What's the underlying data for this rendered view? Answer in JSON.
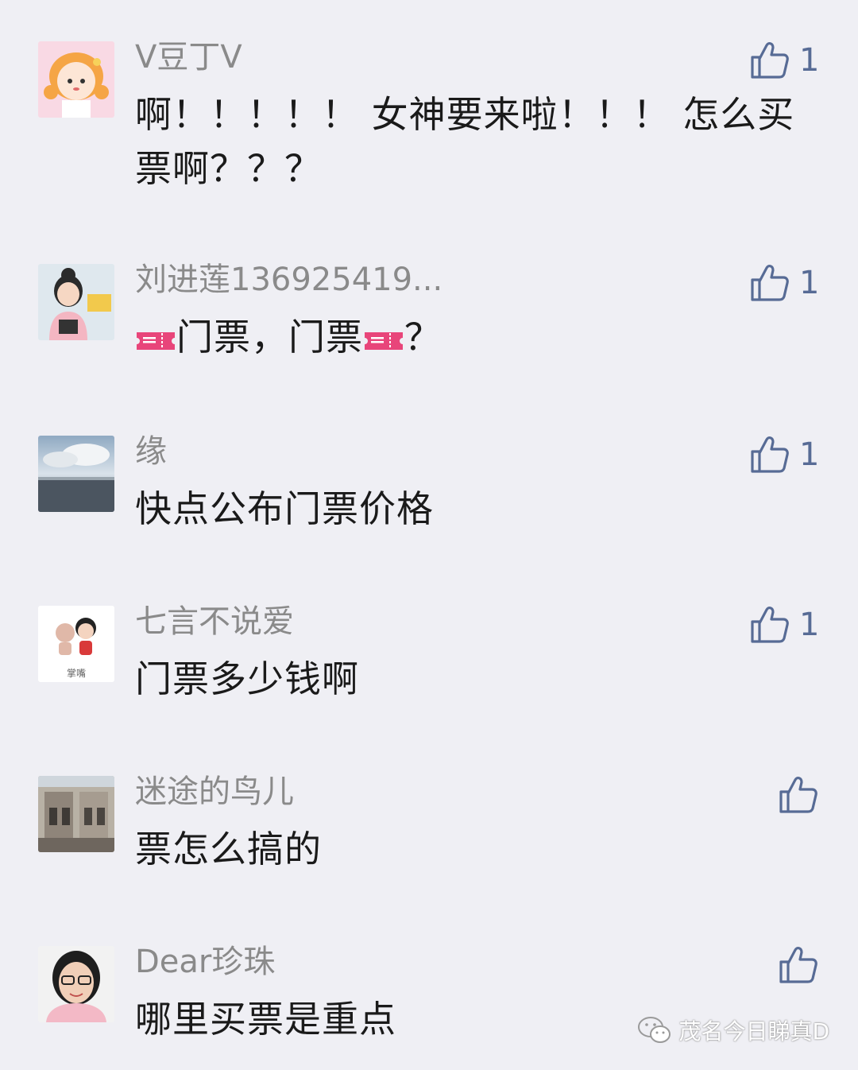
{
  "comments": [
    {
      "nickname": "V豆丁V",
      "content_line1": "啊！！！！！ 女神要来啦！！！ 怎么买",
      "content_line2": "票啊？？？",
      "likes": "1",
      "avatar": "cartoon-girl-orange-hair"
    },
    {
      "nickname": "刘进莲136925419...",
      "content_part1": "门票，门票",
      "content_part2": "？",
      "likes": "1",
      "avatar": "child-photo"
    },
    {
      "nickname": "缘",
      "content": "快点公布门票价格",
      "likes": "1",
      "avatar": "sea-landscape"
    },
    {
      "nickname": "七言不说爱",
      "content": "门票多少钱啊",
      "likes": "1",
      "avatar": "cartoon-couple",
      "avatar_caption": "掌嘴"
    },
    {
      "nickname": "迷途的鸟儿",
      "content": "票怎么搞的",
      "likes": "",
      "avatar": "building-photo"
    },
    {
      "nickname": "Dear珍珠",
      "content": "哪里买票是重点",
      "likes": "",
      "avatar": "woman-portrait"
    }
  ],
  "watermark": {
    "text": "茂名今日睇真D",
    "icon": "wechat-icon"
  },
  "colors": {
    "background": "#efeff4",
    "nickname": "#8a8a8a",
    "like_accent": "#576b95",
    "ticket_emoji": "#e8457a"
  },
  "icons": {
    "like": "thumbs-up-icon",
    "ticket": "ticket-emoji-icon"
  }
}
